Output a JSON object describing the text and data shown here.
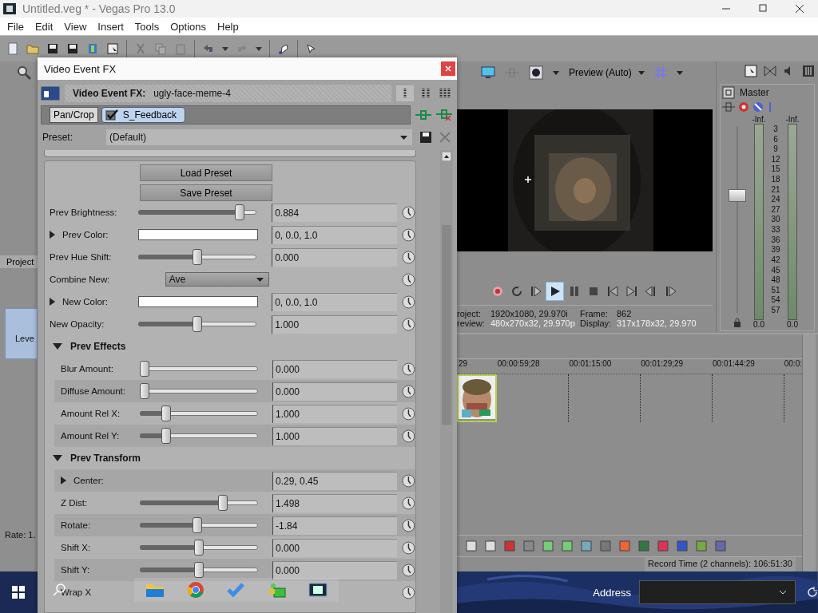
{
  "window": {
    "title": "Untitled.veg * - Vegas Pro 13.0"
  },
  "menu": [
    "File",
    "Edit",
    "View",
    "Insert",
    "Tools",
    "Options",
    "Help"
  ],
  "left_panel": {
    "tab": "Project",
    "track_label": "Leve",
    "rate": "Rate: 1."
  },
  "preview": {
    "quality": "Preview (Auto)",
    "transport": [
      {
        "kind": "record",
        "selected": false
      },
      {
        "kind": "loop",
        "selected": false
      },
      {
        "kind": "play-start",
        "selected": false
      },
      {
        "kind": "play",
        "selected": true
      },
      {
        "kind": "pause",
        "selected": false
      },
      {
        "kind": "stop",
        "selected": false
      },
      {
        "kind": "prev",
        "selected": false
      },
      {
        "kind": "next",
        "selected": false
      },
      {
        "kind": "frame-back",
        "selected": false
      },
      {
        "kind": "frame-forward",
        "selected": false
      }
    ],
    "info": [
      {
        "label": "roject:",
        "value": "1920x1080, 29.970i"
      },
      {
        "label": "Frame:",
        "value": "862"
      },
      {
        "label": "review:",
        "value": "480x270x32, 29.970p"
      },
      {
        "label": "Display:",
        "value": "317x178x32, 29.970"
      }
    ]
  },
  "master": {
    "title": "Master",
    "peaks": [
      "-Inf.",
      "-Inf."
    ],
    "scale": [
      "3",
      "6",
      "9",
      "12",
      "15",
      "18",
      "21",
      "24",
      "27",
      "30",
      "33",
      "36",
      "39",
      "42",
      "45",
      "48",
      "51",
      "54",
      "57"
    ],
    "readings": [
      "0.0",
      "0.0"
    ],
    "fader": {
      "level": 0.63
    }
  },
  "timeline": {
    "ticks": [
      "29",
      "00:00:59;28",
      "00:01:15:00",
      "00:01:29;29",
      "00:01:44:29",
      "00:0:"
    ]
  },
  "status_bar": "Record Time (2 channels): 106:51:30",
  "taskbar": {
    "address_label": "Address"
  },
  "dialog": {
    "title": "Video Event FX",
    "header_label": "Video Event FX:",
    "event_name": "ugly-face-meme-4",
    "chain": [
      {
        "label": "Pan/Crop",
        "kind": "fixed",
        "selected": false
      },
      {
        "label": "S_Feedback",
        "kind": "plugin",
        "selected": true,
        "checked": true
      }
    ],
    "preset": {
      "label": "Preset:",
      "value": "(Default)"
    },
    "buttons": [
      "Load Preset",
      "Save Preset"
    ],
    "params": [
      {
        "kind": "slider",
        "label": "Prev Brightness:",
        "level": 0.89,
        "value": "0.884"
      },
      {
        "kind": "color",
        "label": "Prev Color:",
        "expanded": false,
        "value": "0, 0.0, 1.0"
      },
      {
        "kind": "slider",
        "label": "Prev Hue Shift:",
        "level": 0.5,
        "value": "0.000"
      },
      {
        "kind": "dropdown",
        "label": "Combine New:",
        "value": "Ave"
      },
      {
        "kind": "color",
        "label": "New Color:",
        "expanded": false,
        "value": "0, 0.0, 1.0"
      },
      {
        "kind": "slider",
        "label": "New Opacity:",
        "level": 0.5,
        "value": "1.000"
      },
      {
        "kind": "section",
        "label": "Prev Effects",
        "expanded": true,
        "children": [
          {
            "kind": "slider",
            "label": "Blur Amount:",
            "level": 0,
            "value": "0.000"
          },
          {
            "kind": "slider",
            "label": "Diffuse Amount:",
            "level": 0,
            "value": "0.000"
          },
          {
            "kind": "slider",
            "label": "Amount Rel X:",
            "level": 0.2,
            "value": "1.000"
          },
          {
            "kind": "slider",
            "label": "Amount Rel Y:",
            "level": 0.2,
            "value": "1.000"
          }
        ]
      },
      {
        "kind": "section",
        "label": "Prev Transform",
        "expanded": true,
        "children": [
          {
            "kind": "point",
            "label": "Center:",
            "expanded": false,
            "value": "0.29, 0.45"
          },
          {
            "kind": "slider",
            "label": "Z Dist:",
            "level": 0.72,
            "value": "1.498"
          },
          {
            "kind": "slider",
            "label": "Rotate:",
            "level": 0.49,
            "value": "-1.84"
          },
          {
            "kind": "slider",
            "label": "Shift X:",
            "level": 0.5,
            "value": "0.000"
          },
          {
            "kind": "slider",
            "label": "Shift Y:",
            "level": 0.5,
            "value": "0.000"
          },
          {
            "kind": "plain",
            "label": "Wrap X"
          }
        ]
      }
    ]
  }
}
